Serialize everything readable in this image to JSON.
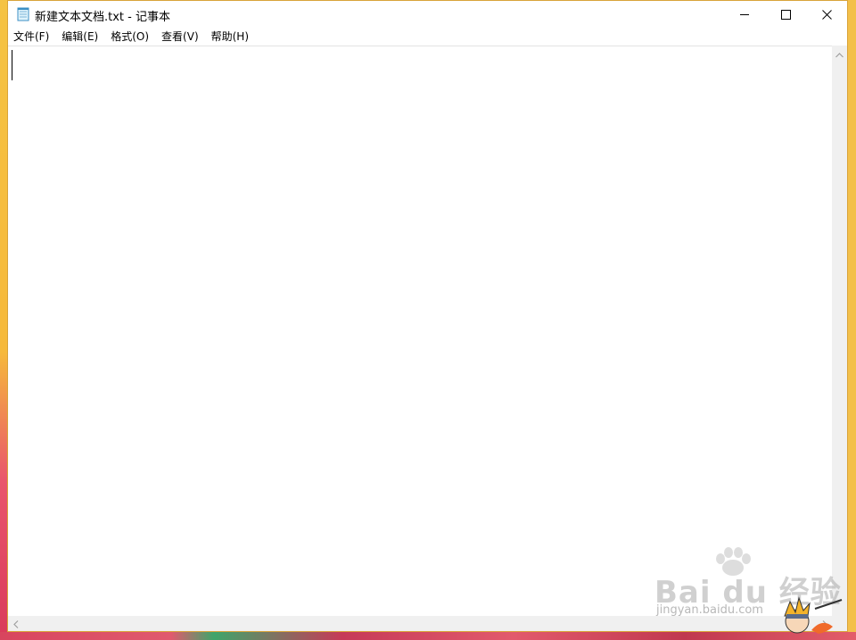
{
  "window": {
    "title": "新建文本文档.txt - 记事本",
    "controls": {
      "minimize": "minimize",
      "maximize": "maximize",
      "close": "close"
    }
  },
  "menu": [
    {
      "label": "文件(F)"
    },
    {
      "label": "编辑(E)"
    },
    {
      "label": "格式(O)"
    },
    {
      "label": "查看(V)"
    },
    {
      "label": "帮助(H)"
    }
  ],
  "editor": {
    "content": ""
  },
  "watermark": {
    "brand": "Bai du 经验",
    "url": "jingyan.baidu.com"
  },
  "icons": {
    "app": "notepad-icon",
    "minimize": "minimize-icon",
    "maximize": "maximize-icon",
    "close": "close-icon"
  },
  "colors": {
    "window_border": "#d9a43a",
    "scrollbar": "#f0f0f0"
  }
}
